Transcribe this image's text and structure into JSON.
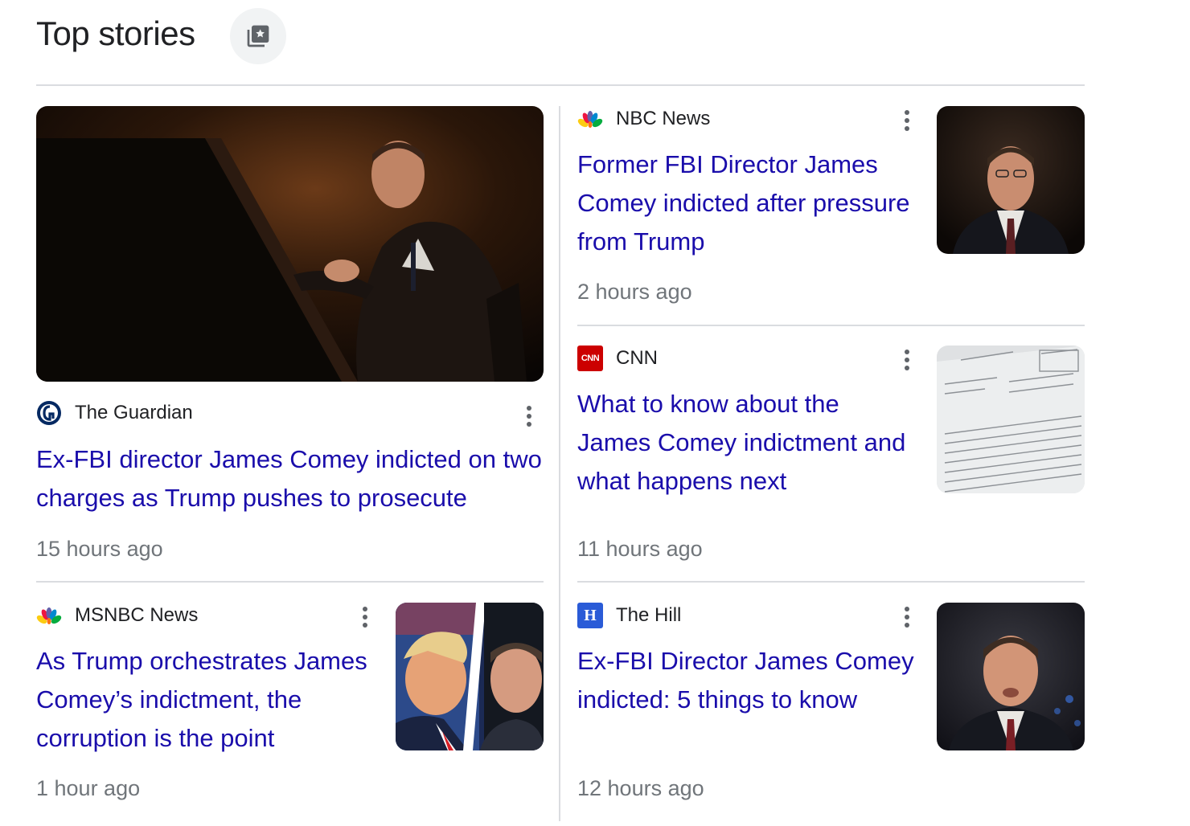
{
  "header": {
    "title": "Top stories",
    "button_icon": "newspaper-star-icon"
  },
  "stories": [
    {
      "source": "The Guardian",
      "logo_icon": "guardian-logo-icon",
      "headline": "Ex-FBI director James Comey indicted on two charges as Trump pushes to prosecute",
      "time": "15 hours ago",
      "image": "comey-seated-hearing-photo"
    },
    {
      "source": "NBC News",
      "logo_icon": "nbc-peacock-logo-icon",
      "headline": "Former FBI Director James Comey indicted after pressure from Trump",
      "time": "2 hours ago",
      "image": "comey-portrait-photo"
    },
    {
      "source": "CNN",
      "logo_icon": "cnn-logo-icon",
      "logo_text": "CNN",
      "headline": "What to know about the James Comey indictment and what happens next",
      "time": "11 hours ago",
      "image": "indictment-document-photo"
    },
    {
      "source": "MSNBC News",
      "logo_icon": "msnbc-peacock-logo-icon",
      "headline": "As Trump orchestrates James Comey’s indictment, the corruption is the point",
      "time": "1 hour ago",
      "image": "trump-comey-split-photo"
    },
    {
      "source": "The Hill",
      "logo_icon": "the-hill-logo-icon",
      "logo_text": "H",
      "headline": "Ex-FBI Director James Comey indicted: 5 things to know",
      "time": "12 hours ago",
      "image": "comey-testifying-photo"
    }
  ],
  "colors": {
    "link": "#1a0dab",
    "meta": "#70757a",
    "divider": "#dadce0",
    "cnn_red": "#cc0000",
    "hill_blue": "#2a5bd7"
  }
}
